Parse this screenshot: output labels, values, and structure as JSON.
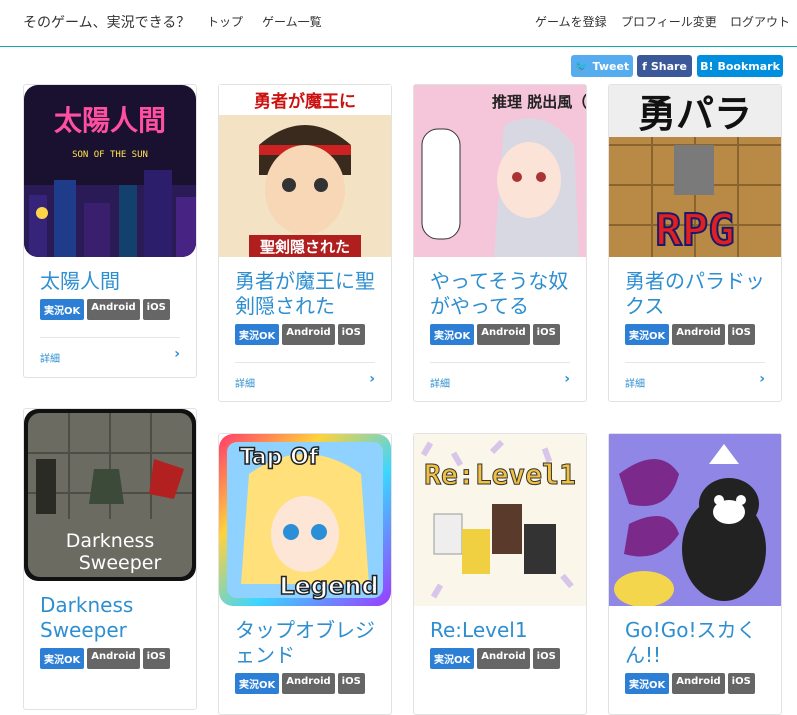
{
  "nav": {
    "brand": "そのゲーム、実況できる？",
    "top": "トップ",
    "list": "ゲーム一覧",
    "register": "ゲームを登録",
    "profile": "プロフィール変更",
    "logout": "ログアウト"
  },
  "share": {
    "tweet": "Tweet",
    "share": "Share",
    "bookmark": "Bookmark"
  },
  "tags": {
    "ok": "実況OK",
    "android": "Android",
    "ios": "iOS"
  },
  "detail": "詳細",
  "games": [
    {
      "title": "太陽人間",
      "art": "SON OF THE SUN"
    },
    {
      "title": "勇者が魔王に聖剣隠された",
      "art": "勇者が魔王に"
    },
    {
      "title": "やってそうな奴がやってる",
      "art": "推理 脱出風（笑）ゲーム"
    },
    {
      "title": "勇者のパラドックス",
      "art": "勇パラ"
    },
    {
      "title": "Darkness Sweeper",
      "art": "Darkness Sweeper"
    },
    {
      "title": "タップオブレジェンド",
      "art": "Tap Of Legend"
    },
    {
      "title": "Re:Level1",
      "art": "Re:Level1"
    },
    {
      "title": "Go!Go!スカくん!!",
      "art": ""
    }
  ],
  "colors": {
    "accent": "#2e8fd0",
    "twitter": "#55acee",
    "facebook": "#3b5998",
    "hatena": "#008fde",
    "ok": "#2d7fd6"
  }
}
